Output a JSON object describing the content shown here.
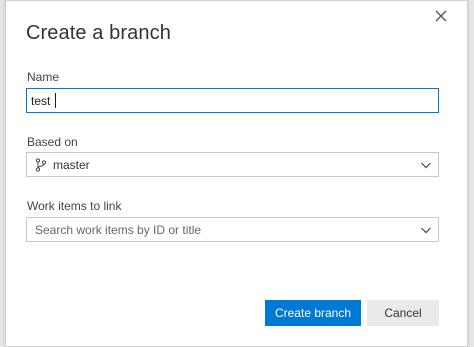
{
  "dialog": {
    "title": "Create a branch",
    "close_icon": "close-icon"
  },
  "name_field": {
    "label": "Name",
    "value": "test"
  },
  "based_on": {
    "label": "Based on",
    "selected": "master",
    "icon": "branch-icon"
  },
  "work_items": {
    "label": "Work items to link",
    "placeholder": "Search work items by ID or title"
  },
  "buttons": {
    "create": "Create branch",
    "cancel": "Cancel"
  },
  "colors": {
    "accent": "#0078d4",
    "secondary_button": "#eaeaea"
  }
}
